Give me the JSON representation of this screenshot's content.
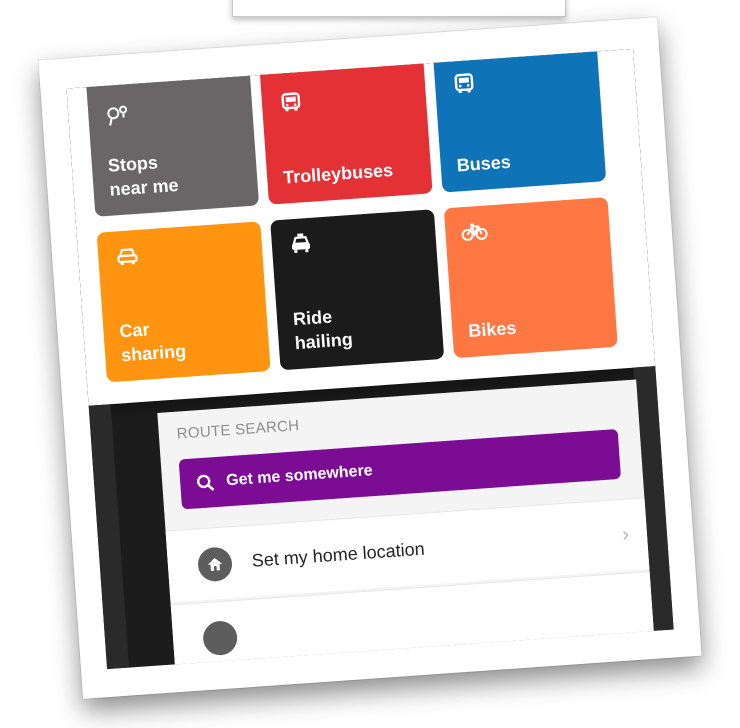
{
  "tiles": [
    {
      "id": "stops",
      "label": "Stops\nnear me",
      "icon": "map-pins-icon",
      "color": "#6a6668"
    },
    {
      "id": "trolleybuses",
      "label": "Trolleybuses",
      "icon": "trolleybus-icon",
      "color": "#e33136"
    },
    {
      "id": "buses",
      "label": "Buses",
      "icon": "bus-icon",
      "color": "#0e74b7"
    },
    {
      "id": "car_sharing",
      "label": "Car\nsharing",
      "icon": "car-icon",
      "color": "#ff9410"
    },
    {
      "id": "ride_hailing",
      "label": "Ride\nhailing",
      "icon": "taxi-icon",
      "color": "#1b1b1b"
    },
    {
      "id": "bikes",
      "label": "Bikes",
      "icon": "bike-icon",
      "color": "#ff7742"
    }
  ],
  "route_search": {
    "title": "ROUTE SEARCH",
    "search_label": "Get me somewhere",
    "search_color": "#7b0c93",
    "rows": [
      {
        "label": "Set my home location",
        "icon": "home-icon"
      }
    ]
  }
}
